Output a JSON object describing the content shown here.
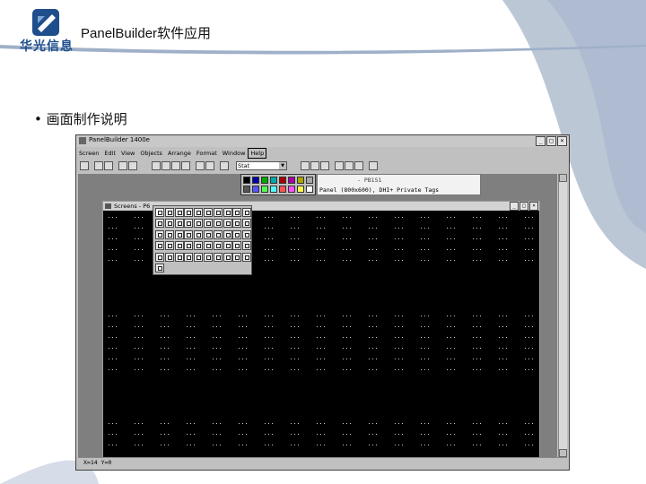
{
  "slide": {
    "logo_text": "华光信息",
    "title": "PanelBuilder软件应用",
    "bullet": "画面制作说明"
  },
  "app": {
    "title": "PanelBuilder 1400e",
    "window_buttons": [
      "_",
      "□",
      "×"
    ],
    "menu": [
      "Screen",
      "Edit",
      "View",
      "Objects",
      "Arrange",
      "Format",
      "Window",
      "Help"
    ],
    "active_menu": "Help",
    "combo_value": "Stat",
    "panel_header": {
      "line1": "- PB1S1",
      "line2": "Panel (800x600), DHI+ Private Tags"
    },
    "palette_colors": [
      "#000000",
      "#0000a8",
      "#00a800",
      "#00a8a8",
      "#a80000",
      "#a800a8",
      "#a8a800",
      "#a8a8a8",
      "#545454",
      "#5454fc",
      "#54fc54",
      "#54fcfc",
      "#fc5454",
      "#fc54fc",
      "#fcfc54",
      "#fcfcfc"
    ],
    "child": {
      "title": "Screens - P6",
      "buttons": [
        "_",
        "□",
        "×"
      ]
    },
    "status": "X=14 Y=0"
  }
}
